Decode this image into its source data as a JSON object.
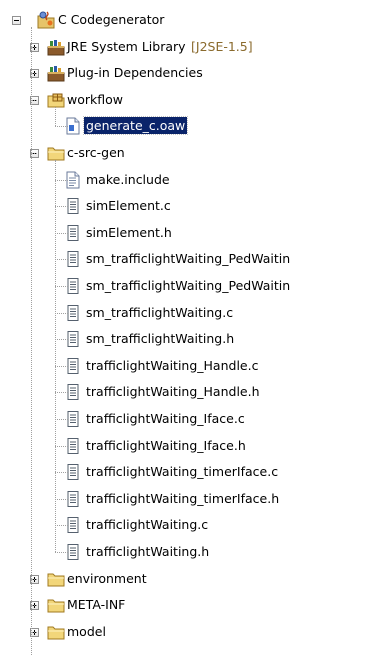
{
  "project": {
    "label": "C Codegenerator",
    "icon": "java-project-icon",
    "expanded": true
  },
  "children": [
    {
      "label": "JRE System Library",
      "decoration": "[J2SE-1.5]",
      "icon": "library-icon",
      "expandable": true,
      "expanded": false
    },
    {
      "label": "Plug-in Dependencies",
      "icon": "library-icon",
      "expandable": true,
      "expanded": false
    },
    {
      "label": "workflow",
      "icon": "package-folder-icon",
      "expandable": true,
      "expanded": true,
      "children": [
        {
          "label": "generate_c.oaw",
          "icon": "oaw-file-icon",
          "selected": true
        }
      ]
    },
    {
      "label": "c-src-gen",
      "icon": "folder-icon",
      "expandable": true,
      "expanded": true,
      "children": [
        {
          "label": "make.include",
          "icon": "text-file-icon"
        },
        {
          "label": "simElement.c",
          "icon": "source-file-icon"
        },
        {
          "label": "simElement.h",
          "icon": "source-file-icon"
        },
        {
          "label": "sm_trafficlightWaiting_PedWaitin",
          "icon": "source-file-icon"
        },
        {
          "label": "sm_trafficlightWaiting_PedWaitin",
          "icon": "source-file-icon"
        },
        {
          "label": "sm_trafficlightWaiting.c",
          "icon": "source-file-icon"
        },
        {
          "label": "sm_trafficlightWaiting.h",
          "icon": "source-file-icon"
        },
        {
          "label": "trafficlightWaiting_Handle.c",
          "icon": "source-file-icon"
        },
        {
          "label": "trafficlightWaiting_Handle.h",
          "icon": "source-file-icon"
        },
        {
          "label": "trafficlightWaiting_Iface.c",
          "icon": "source-file-icon"
        },
        {
          "label": "trafficlightWaiting_Iface.h",
          "icon": "source-file-icon"
        },
        {
          "label": "trafficlightWaiting_timerIface.c",
          "icon": "source-file-icon"
        },
        {
          "label": "trafficlightWaiting_timerIface.h",
          "icon": "source-file-icon"
        },
        {
          "label": "trafficlightWaiting.c",
          "icon": "source-file-icon"
        },
        {
          "label": "trafficlightWaiting.h",
          "icon": "source-file-icon"
        }
      ]
    },
    {
      "label": "environment",
      "icon": "folder-icon",
      "expandable": true,
      "expanded": false
    },
    {
      "label": "META-INF",
      "icon": "folder-icon",
      "expandable": true,
      "expanded": false
    },
    {
      "label": "model",
      "icon": "folder-icon",
      "expandable": true,
      "expanded": false
    }
  ],
  "colors": {
    "selection_bg": "#0a246a",
    "selection_fg": "#ffffff",
    "decoration": "#8a6a2d",
    "folder_yellow": "#f2d67a",
    "connector": "#a0a0a0"
  }
}
